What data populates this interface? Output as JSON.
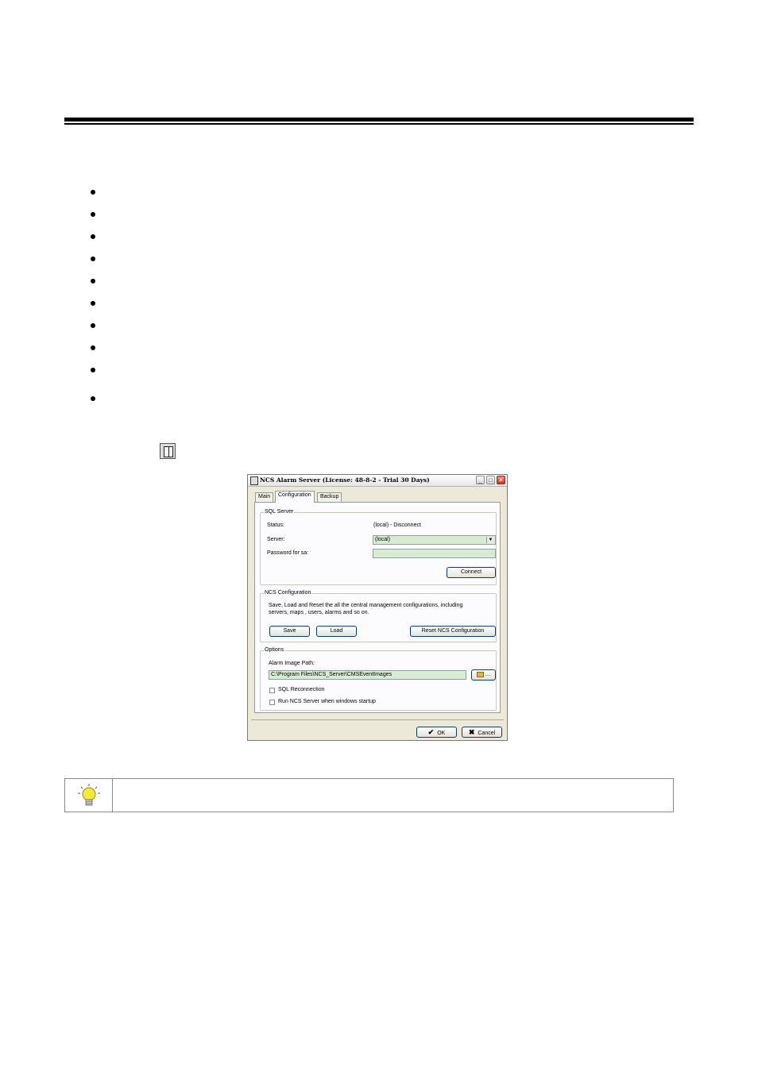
{
  "dialog": {
    "title": "NCS Alarm Server (License: 48-8-2 - Trial 30 Days)",
    "tabs": [
      "Main",
      "Configuration",
      "Backup"
    ],
    "active_tab": "Configuration",
    "sql_server": {
      "legend": "SQL Server",
      "status_label": "Status:",
      "status_value": "(local) - Disconnect",
      "server_label": "Server:",
      "server_value": "(local)",
      "password_label": "Password for sa:",
      "password_value": "",
      "connect_label": "Connect"
    },
    "ncs_config": {
      "legend": "NCS Configuration",
      "description": "Save, Load and Reset the all the central management configurations, including servers, maps , users, alarms and so on.",
      "save_label": "Save",
      "load_label": "Load",
      "reset_label": "Reset NCS Configuration"
    },
    "options": {
      "legend": "Options",
      "path_label": "Alarm Image Path:",
      "path_value": "C:\\Program Files\\NCS_Server\\CMSEventImages",
      "browse_label": "…",
      "sql_reconnection_label": "SQL Reconnection",
      "run_on_startup_label": "Run NCS Server when windows startup"
    },
    "ok_label": "OK",
    "cancel_label": "Cancel"
  },
  "icons": {
    "window_icon": "window-icon",
    "tip_icon": "lightbulb-icon"
  },
  "colors": {
    "field_bg": "#d7ecd2",
    "dialog_bg": "#ece9d8",
    "close_button": "#c8382a"
  }
}
